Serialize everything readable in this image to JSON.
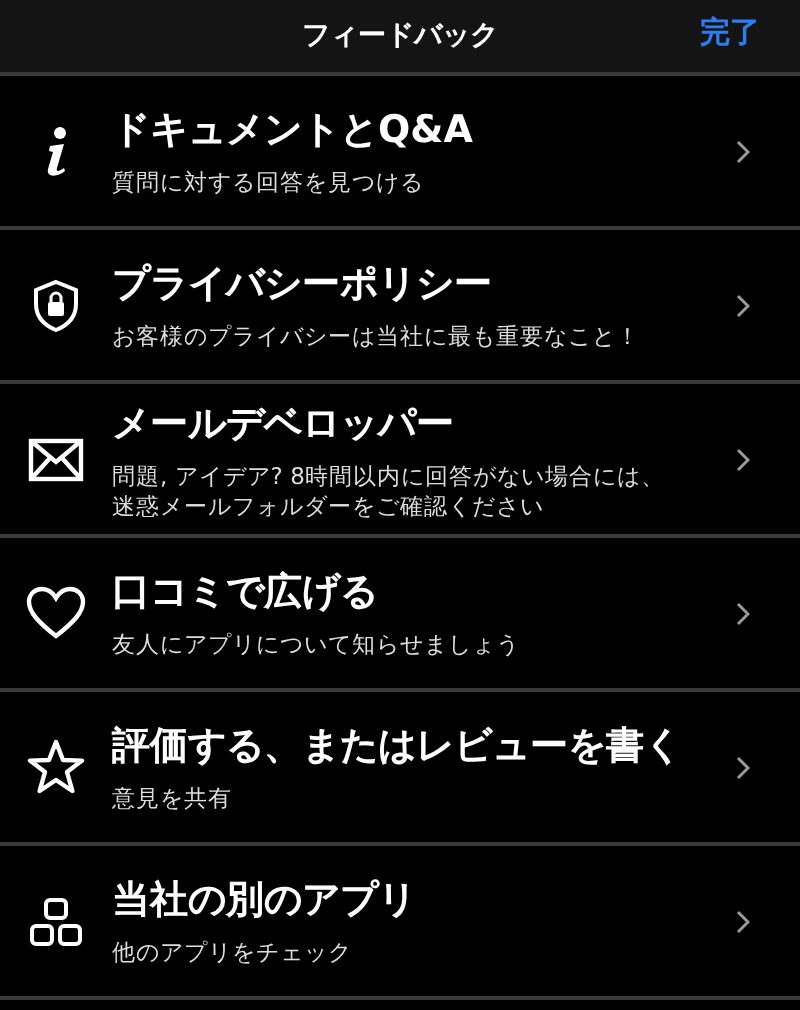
{
  "header": {
    "title": "フィードバック",
    "done": "完了"
  },
  "items": [
    {
      "title": "ドキュメントとQ&A",
      "subtitle": "質問に対する回答を見つける"
    },
    {
      "title": "プライバシーポリシー",
      "subtitle": "お客様のプライバシーは当社に最も重要なこと！"
    },
    {
      "title": "メールデベロッパー",
      "subtitle": "問題, アイデア? 8時間以内に回答がない場合には、迷惑メールフォルダーをご確認ください"
    },
    {
      "title": "口コミで広げる",
      "subtitle": "友人にアプリについて知らせましょう"
    },
    {
      "title": "評価する、またはレビューを書く",
      "subtitle": "意見を共有"
    },
    {
      "title": "当社の別のアプリ",
      "subtitle": "他のアプリをチェック"
    }
  ]
}
